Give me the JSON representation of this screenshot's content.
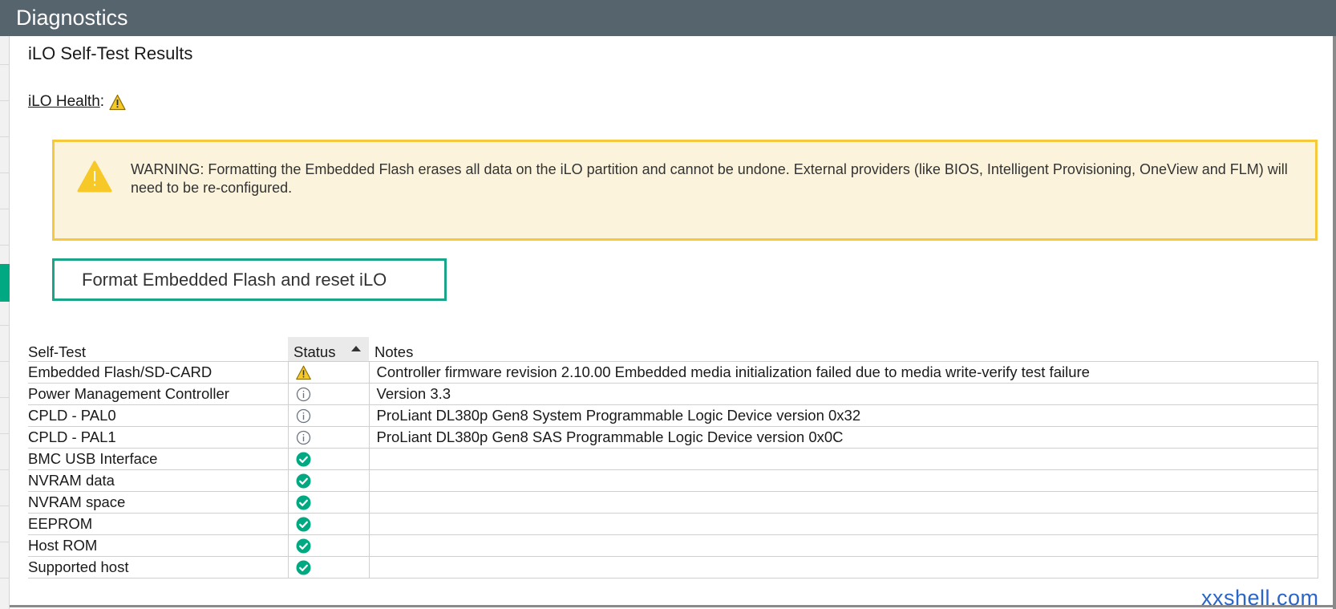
{
  "window": {
    "title": "Diagnostics"
  },
  "section": {
    "title": "iLO Self-Test Results"
  },
  "health": {
    "label": "iLO Health",
    "separator": ":",
    "status_icon": "warning-icon"
  },
  "warning": {
    "icon": "warning-icon",
    "text": "WARNING: Formatting the Embedded Flash erases all data on the iLO partition and cannot be undone. External providers (like BIOS, Intelligent Provisioning, OneView and FLM) will need to be re-configured."
  },
  "format_button": {
    "label": "Format Embedded Flash and reset iLO"
  },
  "table": {
    "headers": {
      "self_test": "Self-Test",
      "status": "Status",
      "notes": "Notes"
    },
    "sort": {
      "column": "Status",
      "direction": "ascending"
    },
    "rows": [
      {
        "name": "Embedded Flash/SD-CARD",
        "status": "warning",
        "notes": "Controller firmware revision 2.10.00 Embedded media initialization failed due to media write-verify test failure"
      },
      {
        "name": "Power Management Controller",
        "status": "info",
        "notes": "Version 3.3"
      },
      {
        "name": "CPLD - PAL0",
        "status": "info",
        "notes": "ProLiant DL380p Gen8 System Programmable Logic Device version 0x32"
      },
      {
        "name": "CPLD - PAL1",
        "status": "info",
        "notes": "ProLiant DL380p Gen8 SAS Programmable Logic Device version 0x0C"
      },
      {
        "name": "BMC USB Interface",
        "status": "ok",
        "notes": ""
      },
      {
        "name": "NVRAM data",
        "status": "ok",
        "notes": ""
      },
      {
        "name": "NVRAM space",
        "status": "ok",
        "notes": ""
      },
      {
        "name": "EEPROM",
        "status": "ok",
        "notes": ""
      },
      {
        "name": "Host ROM",
        "status": "ok",
        "notes": ""
      },
      {
        "name": "Supported host",
        "status": "ok",
        "notes": ""
      }
    ]
  },
  "status_icons": {
    "warning": "warning-icon",
    "info": "info-icon",
    "ok": "check-circle-icon"
  },
  "colors": {
    "titlebar": "#56646e",
    "accent": "#01a982",
    "warning_border": "#f5c93b",
    "warning_bg": "#fbf3dc"
  },
  "watermark": {
    "text": "xxshell.com"
  }
}
